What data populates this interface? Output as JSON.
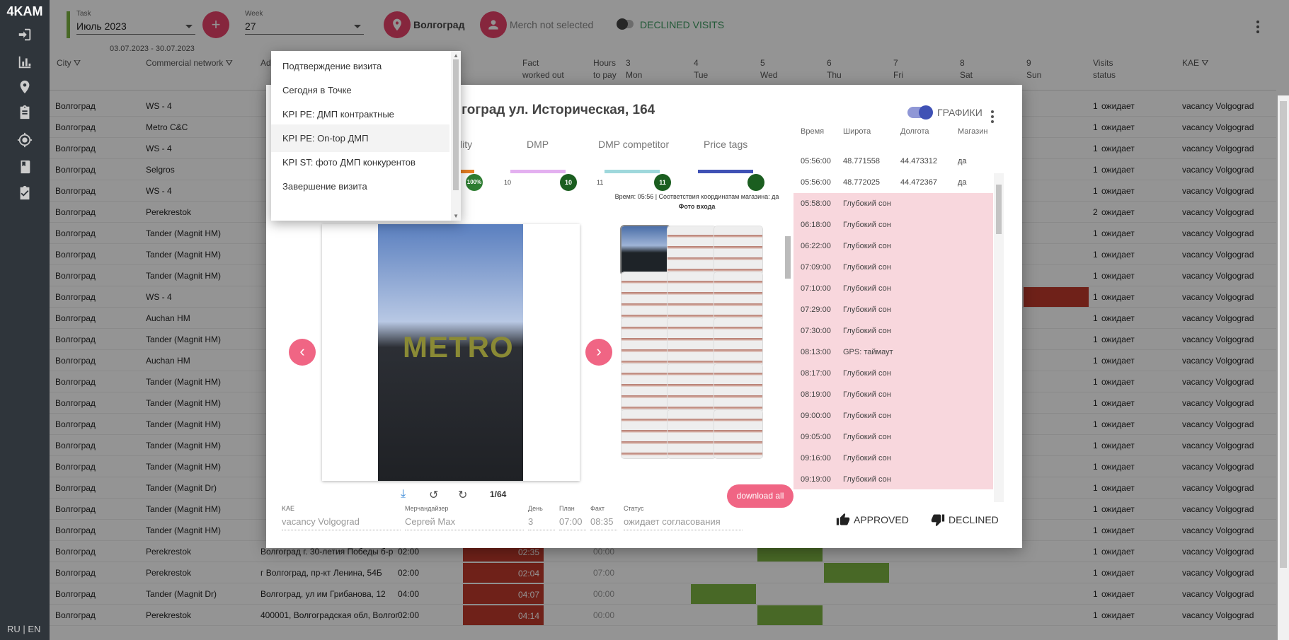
{
  "app": {
    "logo": "4KAM",
    "lang": "RU | EN"
  },
  "topbar": {
    "task_label": "Task",
    "task_value": "Июль 2023",
    "task_range": "03.07.2023 - 30.07.2023",
    "week_label": "Week",
    "week_value": "27",
    "city": "Волгоград",
    "merch": "Merch not selected",
    "declined": "DECLINED VISITS"
  },
  "grid": {
    "headers": {
      "city": "City",
      "network": "Commercial network",
      "ad": "Ad",
      "fact": "Fact",
      "fact2": "worked out",
      "hours": "Hours",
      "hours2": "to pay",
      "d3": "3",
      "d3b": "Mon",
      "d4": "4",
      "d4b": "Tue",
      "d5": "5",
      "d5b": "Wed",
      "d6": "6",
      "d6b": "Thu",
      "d7": "7",
      "d7b": "Fri",
      "d8": "8",
      "d8b": "Sat",
      "d9": "9",
      "d9b": "Sun",
      "visits": "Visits",
      "visits2": "status",
      "kae": "KAE"
    },
    "rows": [
      {
        "city": "Волгоград",
        "net": "WS - 4",
        "addr": "",
        "plan": "",
        "count": "1",
        "status": "ожидает",
        "kae": "vacancy Volgograd"
      },
      {
        "city": "Волгоград",
        "net": "Metro C&C",
        "addr": "",
        "plan": "",
        "count": "1",
        "status": "ожидает",
        "kae": "vacancy Volgograd"
      },
      {
        "city": "Волгоград",
        "net": "WS - 4",
        "addr": "",
        "plan": "",
        "count": "1",
        "status": "ожидает",
        "kae": "vacancy Volgograd"
      },
      {
        "city": "Волгоград",
        "net": "Selgros",
        "addr": "",
        "plan": "",
        "count": "1",
        "status": "ожидает",
        "kae": "vacancy Volgograd"
      },
      {
        "city": "Волгоград",
        "net": "WS - 4",
        "addr": "",
        "plan": "",
        "count": "1",
        "status": "ожидает",
        "kae": "vacancy Volgograd"
      },
      {
        "city": "Волгоград",
        "net": "Perekrestok",
        "addr": "",
        "plan": "",
        "count": "2",
        "status": "ожидает",
        "kae": "vacancy Volgograd"
      },
      {
        "city": "Волгоград",
        "net": "Tander (Magnit HM)",
        "addr": "",
        "plan": "",
        "count": "1",
        "status": "ожидает",
        "kae": "vacancy Volgograd"
      },
      {
        "city": "Волгоград",
        "net": "Tander (Magnit HM)",
        "addr": "",
        "plan": "",
        "count": "1",
        "status": "ожидает",
        "kae": "vacancy Volgograd"
      },
      {
        "city": "Волгоград",
        "net": "Tander (Magnit HM)",
        "addr": "",
        "plan": "",
        "count": "1",
        "status": "ожидает",
        "kae": "vacancy Volgograd"
      },
      {
        "city": "Волгоград",
        "net": "WS - 4",
        "addr": "",
        "plan": "",
        "count": "1",
        "status": "ожидает",
        "kae": "vacancy Volgograd"
      },
      {
        "city": "Волгоград",
        "net": "Auchan HM",
        "addr": "",
        "plan": "",
        "count": "1",
        "status": "ожидает",
        "kae": "vacancy Volgograd"
      },
      {
        "city": "Волгоград",
        "net": "Tander (Magnit HM)",
        "addr": "",
        "plan": "",
        "count": "1",
        "status": "ожидает",
        "kae": "vacancy Volgograd"
      },
      {
        "city": "Волгоград",
        "net": "Auchan HM",
        "addr": "",
        "plan": "",
        "count": "1",
        "status": "ожидает",
        "kae": "vacancy Volgograd"
      },
      {
        "city": "Волгоград",
        "net": "Tander (Magnit HM)",
        "addr": "",
        "plan": "",
        "count": "1",
        "status": "ожидает",
        "kae": "vacancy Volgograd"
      },
      {
        "city": "Волгоград",
        "net": "Tander (Magnit HM)",
        "addr": "",
        "plan": "",
        "count": "1",
        "status": "ожидает",
        "kae": "vacancy Volgograd"
      },
      {
        "city": "Волгоград",
        "net": "Tander (Magnit HM)",
        "addr": "",
        "plan": "",
        "count": "1",
        "status": "ожидает",
        "kae": "vacancy Volgograd"
      },
      {
        "city": "Волгоград",
        "net": "Tander (Magnit HM)",
        "addr": "",
        "plan": "",
        "count": "1",
        "status": "ожидает",
        "kae": "vacancy Volgograd"
      },
      {
        "city": "Волгоград",
        "net": "Tander (Magnit HM)",
        "addr": "",
        "plan": "",
        "count": "1",
        "status": "ожидает",
        "kae": "vacancy Volgograd"
      },
      {
        "city": "Волгоград",
        "net": "Tander (Magnit Dr)",
        "addr": "",
        "plan": "",
        "count": "1",
        "status": "ожидает",
        "kae": "vacancy Volgograd"
      },
      {
        "city": "Волгоград",
        "net": "Tander (Magnit HM)",
        "addr": "",
        "plan": "",
        "count": "1",
        "status": "ожидает",
        "kae": "vacancy Volgograd"
      },
      {
        "city": "Волгоград",
        "net": "Tander (Magnit HM)",
        "addr": "",
        "plan": "",
        "count": "1",
        "status": "ожидает",
        "kae": "vacancy Volgograd"
      },
      {
        "city": "Волгоград",
        "net": "Perekrestok",
        "addr": "Волгоград г. 30-летия Победы б-р",
        "plan": "02:00",
        "count": "1",
        "status": "ожидает",
        "kae": "vacancy Volgograd"
      },
      {
        "city": "Волгоград",
        "net": "Perekrestok",
        "addr": "г Волгоград, пр-кт Ленина, 54Б",
        "plan": "02:00",
        "count": "1",
        "status": "ожидает",
        "kae": "vacancy Volgograd"
      },
      {
        "city": "Волгоград",
        "net": "Tander (Magnit Dr)",
        "addr": "Волгоград, ул им Грибанова, 12",
        "plan": "04:00",
        "count": "1",
        "status": "ожидает",
        "kae": "vacancy Volgograd"
      },
      {
        "city": "Волгоград",
        "net": "Perekrestok",
        "addr": "400001, Волгоградская обл, Волгог",
        "plan": "02:00",
        "count": "1",
        "status": "ожидает",
        "kae": "vacancy Volgograd"
      }
    ],
    "row_facts": [
      "02:35",
      "02:04",
      "04:07",
      "04:14"
    ],
    "row_hours": [
      "00:00",
      "07:00",
      "00:00",
      "00:00"
    ]
  },
  "modal": {
    "title": "лгоград ул. Историческая, 164",
    "toggle_label": "ГРАФИКИ",
    "metrics": [
      {
        "label": "ibility",
        "badge": "100%",
        "num": ""
      },
      {
        "label": "DMP",
        "badge": "10",
        "num": "10"
      },
      {
        "label": "DMP competitor",
        "badge": "11",
        "num": "11"
      },
      {
        "label": "Price tags",
        "badge": "",
        "num": ""
      }
    ],
    "coord_text": "Время: 05:56 | Соответствия координатам магазина: да",
    "coord_text2": "Фото входа",
    "photo_text": "METRO",
    "counter": "1/64",
    "download_all": "download all",
    "footer": [
      {
        "label": "KAE",
        "value": "vacancy Volgograd"
      },
      {
        "label": "Мерчандайзер",
        "value": "Сергей Мах"
      },
      {
        "label": "День",
        "value": "3"
      },
      {
        "label": "План",
        "value": "07:00"
      },
      {
        "label": "Факт",
        "value": "08:35"
      },
      {
        "label": "Статус",
        "value": "ожидает согласования"
      }
    ],
    "time_headers": {
      "time": "Время",
      "lat": "Широта",
      "lon": "Долгота",
      "shop": "Магазин"
    },
    "time_rows": [
      {
        "t": "05:56:00",
        "a": "48.771558",
        "b": "44.473312",
        "c": "да",
        "pink": false
      },
      {
        "t": "05:56:00",
        "a": "48.772025",
        "b": "44.472367",
        "c": "да",
        "pink": false
      },
      {
        "t": "05:58:00",
        "a": "Глубокий сон",
        "b": "",
        "c": "",
        "pink": true
      },
      {
        "t": "06:18:00",
        "a": "Глубокий сон",
        "b": "",
        "c": "",
        "pink": true
      },
      {
        "t": "06:22:00",
        "a": "Глубокий сон",
        "b": "",
        "c": "",
        "pink": true
      },
      {
        "t": "07:09:00",
        "a": "Глубокий сон",
        "b": "",
        "c": "",
        "pink": true
      },
      {
        "t": "07:10:00",
        "a": "Глубокий сон",
        "b": "",
        "c": "",
        "pink": true
      },
      {
        "t": "07:29:00",
        "a": "Глубокий сон",
        "b": "",
        "c": "",
        "pink": true
      },
      {
        "t": "07:30:00",
        "a": "Глубокий сон",
        "b": "",
        "c": "",
        "pink": true
      },
      {
        "t": "08:13:00",
        "a": "GPS: таймаут",
        "b": "",
        "c": "",
        "pink": true
      },
      {
        "t": "08:17:00",
        "a": "Глубокий сон",
        "b": "",
        "c": "",
        "pink": true
      },
      {
        "t": "08:19:00",
        "a": "Глубокий сон",
        "b": "",
        "c": "",
        "pink": true
      },
      {
        "t": "09:00:00",
        "a": "Глубокий сон",
        "b": "",
        "c": "",
        "pink": true
      },
      {
        "t": "09:05:00",
        "a": "Глубокий сон",
        "b": "",
        "c": "",
        "pink": true
      },
      {
        "t": "09:16:00",
        "a": "Глубокий сон",
        "b": "",
        "c": "",
        "pink": true
      },
      {
        "t": "09:19:00",
        "a": "Глубокий сон",
        "b": "",
        "c": "",
        "pink": true
      }
    ],
    "approved": "APPROVED",
    "declined": "DECLINED"
  },
  "dropdown": {
    "items": [
      "Подтверждение визита",
      "Сегодня в Точке",
      "KPI PE: ДМП контрактные",
      "KPI PE: On-top ДМП",
      "KPI ST: фото ДМП конкурентов",
      "Завершение визита"
    ]
  },
  "colors": {
    "accent": "#e7436a",
    "green": "#7cb342",
    "red": "#c0392b",
    "pink": "#f8d7dd",
    "toggle": "#3f51b5"
  }
}
